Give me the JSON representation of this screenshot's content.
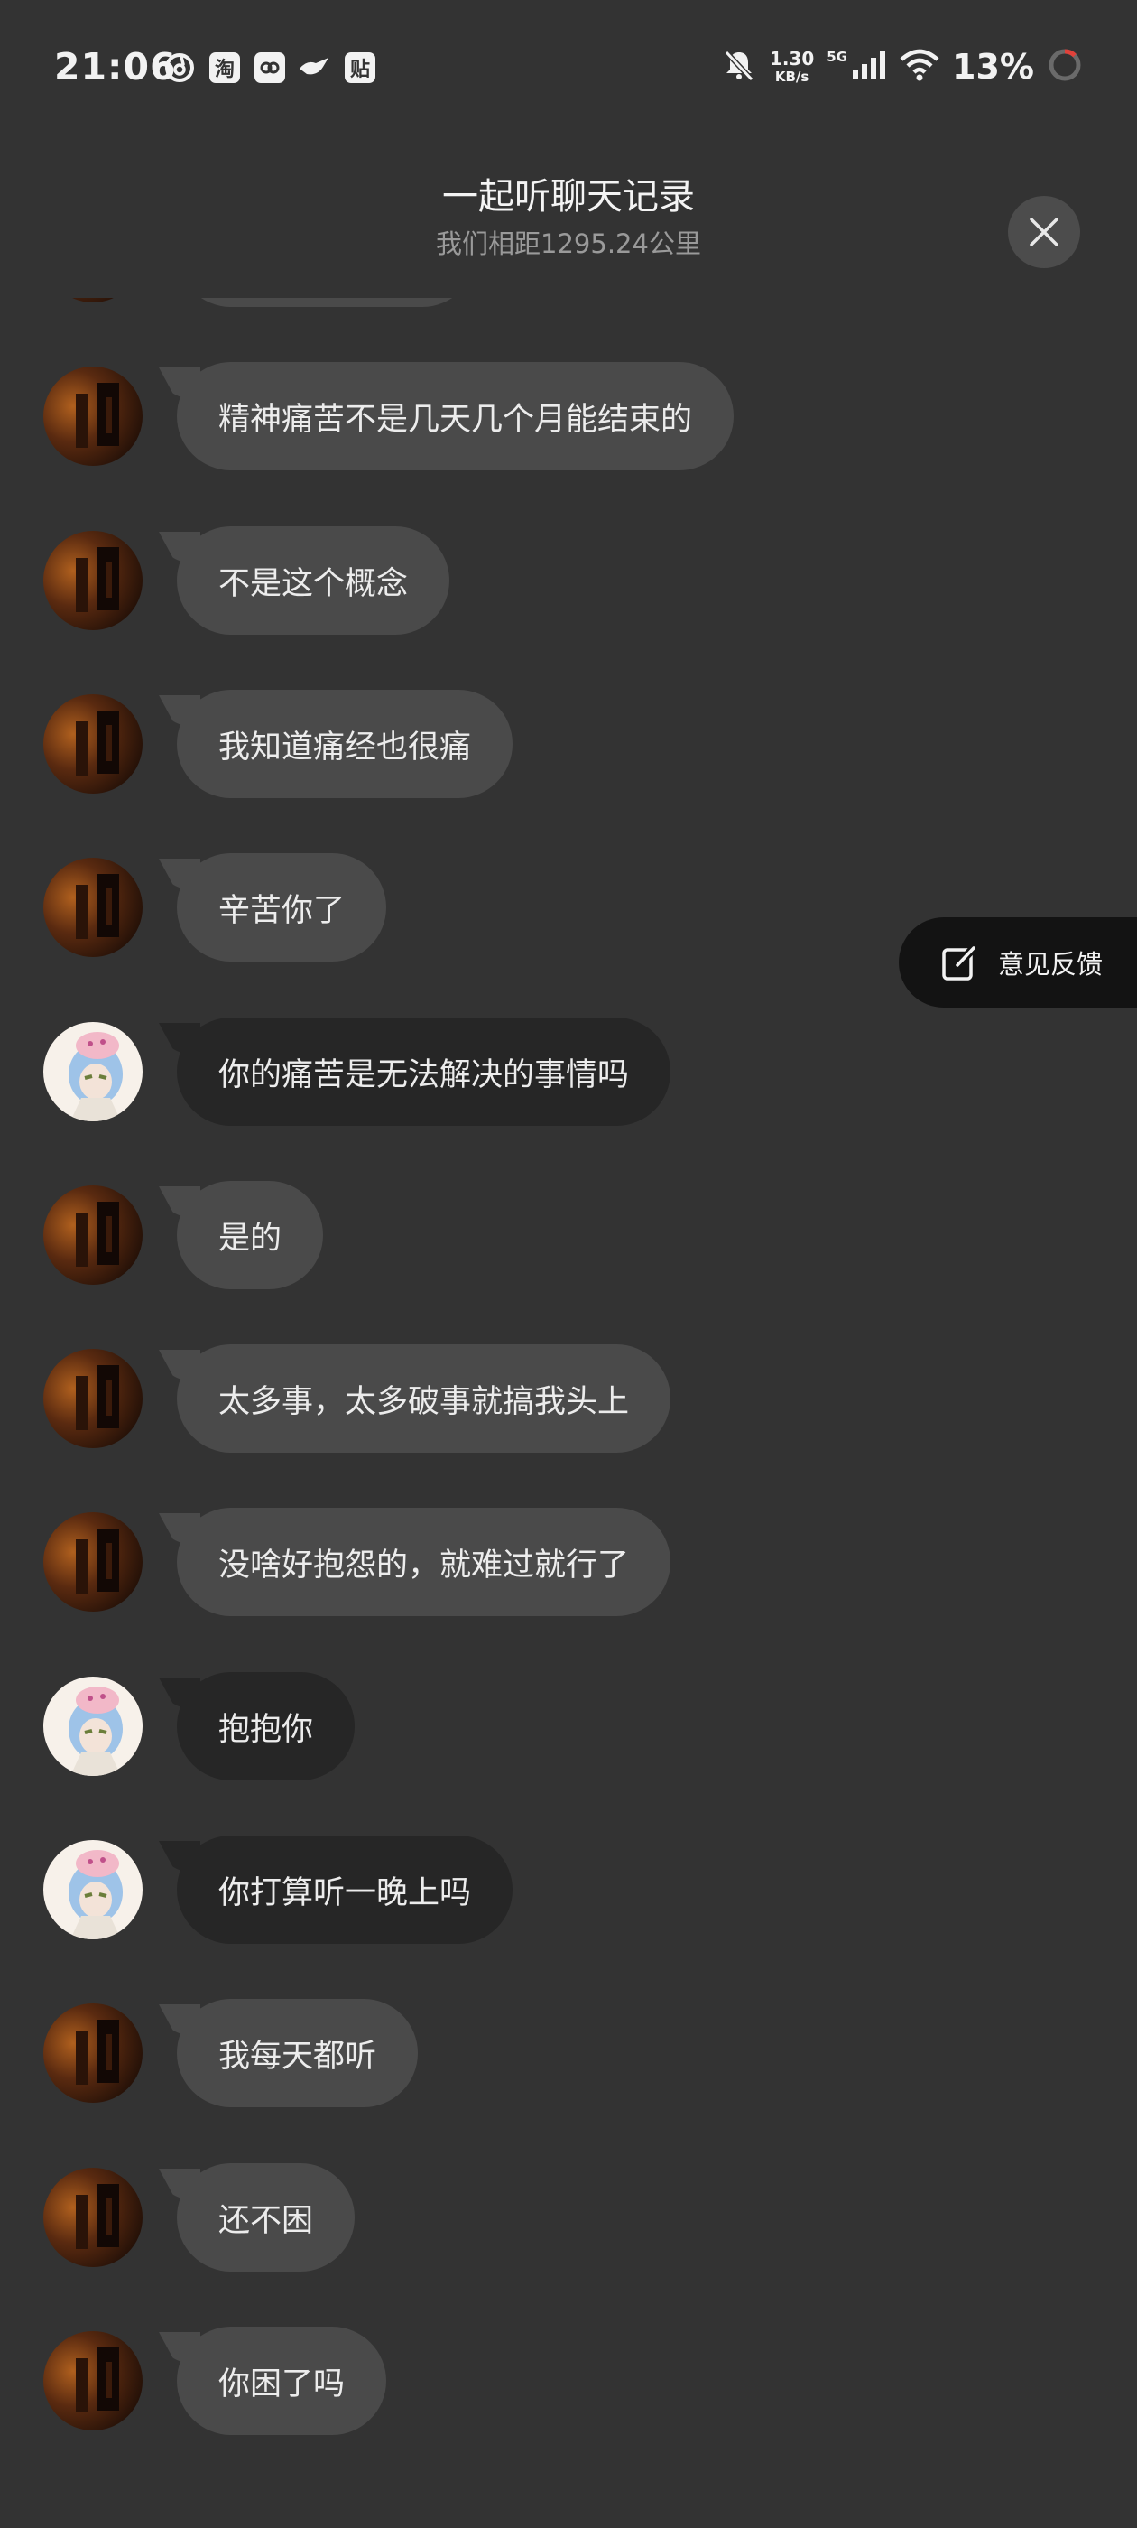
{
  "status_bar": {
    "time": "21:06",
    "notification_icons": [
      {
        "name": "netease-music-icon",
        "glyph": ""
      },
      {
        "name": "taobao-icon",
        "glyph": "淘"
      },
      {
        "name": "bilibili-like-icon",
        "glyph": ""
      },
      {
        "name": "bird-app-icon",
        "glyph": ""
      },
      {
        "name": "tieba-icon",
        "glyph": "贴"
      }
    ],
    "net_speed_value": "1.30",
    "net_speed_unit": "KB/s",
    "signal_label": "5G",
    "battery": "13%"
  },
  "header": {
    "title": "一起听聊天记录",
    "subtitle": "我们相距1295.24公里"
  },
  "messages": [
    {
      "sender": "other",
      "text": ""
    },
    {
      "sender": "other",
      "text": "精神痛苦不是几天几个月能结束的"
    },
    {
      "sender": "other",
      "text": "不是这个概念"
    },
    {
      "sender": "other",
      "text": "我知道痛经也很痛"
    },
    {
      "sender": "other",
      "text": "辛苦你了"
    },
    {
      "sender": "me",
      "text": "你的痛苦是无法解决的事情吗"
    },
    {
      "sender": "other",
      "text": "是的"
    },
    {
      "sender": "other",
      "text": "太多事，太多破事就搞我头上"
    },
    {
      "sender": "other",
      "text": "没啥好抱怨的，就难过就行了"
    },
    {
      "sender": "me",
      "text": "抱抱你"
    },
    {
      "sender": "me",
      "text": "你打算听一晚上吗"
    },
    {
      "sender": "other",
      "text": "我每天都听"
    },
    {
      "sender": "other",
      "text": "还不困"
    },
    {
      "sender": "other",
      "text": "你困了吗"
    }
  ],
  "feedback": {
    "label": "意见反馈"
  },
  "colors": {
    "background": "#333333",
    "bubble_other": "#4a4a4a",
    "bubble_me": "#262626",
    "feedback_bg": "#131313"
  }
}
